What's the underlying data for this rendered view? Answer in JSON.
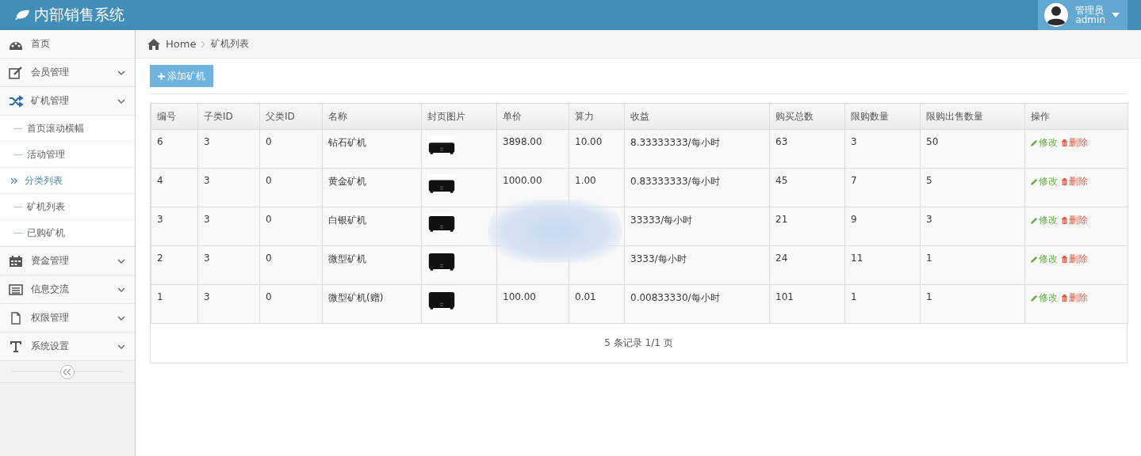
{
  "app": {
    "title": "内部销售系统"
  },
  "user": {
    "role": "管理员",
    "name": "admin"
  },
  "sidebar": {
    "items": [
      {
        "label": "首页",
        "selected": false,
        "submenu": false
      },
      {
        "label": "会员管理",
        "selected": false,
        "submenu": true
      },
      {
        "label": "矿机管理",
        "selected": false,
        "submenu": true,
        "children": [
          {
            "label": "首页滚动横幅",
            "selected": false
          },
          {
            "label": "活动管理",
            "selected": false
          },
          {
            "label": "分类列表",
            "selected": true
          },
          {
            "label": "矿机列表",
            "selected": false
          },
          {
            "label": "已购矿机",
            "selected": false
          }
        ]
      },
      {
        "label": "资金管理",
        "selected": false,
        "submenu": true
      },
      {
        "label": "信息交流",
        "selected": false,
        "submenu": true
      },
      {
        "label": "权限管理",
        "selected": false,
        "submenu": true
      },
      {
        "label": "系统设置",
        "selected": false,
        "submenu": true
      }
    ]
  },
  "breadcrumb": [
    "Home",
    "矿机列表"
  ],
  "add_button": "添加矿机",
  "table": {
    "columns": [
      "编号",
      "子类ID",
      "父类ID",
      "名称",
      "封页图片",
      "单价",
      "算力",
      "收益",
      "购买总数",
      "限购数量",
      "限购出售数量",
      "操作"
    ],
    "rows": [
      {
        "id": "6",
        "child_id": "3",
        "parent_id": "0",
        "name": "钻石矿机",
        "price": "3898.00",
        "power": "10.00",
        "income": "8.33333333/每小时",
        "total": "63",
        "limit": "3",
        "sell_limit": "50",
        "edit": "修改",
        "delete": "删除"
      },
      {
        "id": "4",
        "child_id": "3",
        "parent_id": "0",
        "name": "黄金矿机",
        "price": "1000.00",
        "power": "1.00",
        "income": "0.83333333/每小时",
        "total": "45",
        "limit": "7",
        "sell_limit": "5",
        "edit": "修改",
        "delete": "删除"
      },
      {
        "id": "3",
        "child_id": "3",
        "parent_id": "0",
        "name": "白银矿机",
        "income": "33333/每小时",
        "total": "21",
        "limit": "9",
        "sell_limit": "3",
        "edit": "修改",
        "delete": "删除"
      },
      {
        "id": "2",
        "child_id": "3",
        "parent_id": "0",
        "name": "微型矿机",
        "income": "3333/每小时",
        "total": "24",
        "limit": "11",
        "sell_limit": "1",
        "edit": "修改",
        "delete": "删除"
      },
      {
        "id": "1",
        "child_id": "3",
        "parent_id": "0",
        "name": "微型矿机(赠)",
        "price": "100.00",
        "power": "0.01",
        "income": "0.00833330/每小时",
        "total": "101",
        "limit": "1",
        "sell_limit": "1",
        "edit": "修改",
        "delete": "删除"
      }
    ]
  },
  "pager": "5 条记录 1/1 页"
}
